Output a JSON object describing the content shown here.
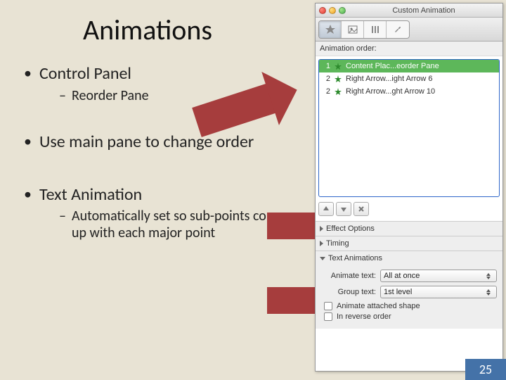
{
  "slide": {
    "title": "Animations",
    "bullets": [
      {
        "text": "Control Panel",
        "sub": [
          "Reorder Pane"
        ]
      },
      {
        "text": "Use main pane to change order",
        "sub": []
      },
      {
        "text": "Text Animation",
        "sub": [
          "Automatically set so sub-points come up with each major point"
        ]
      }
    ],
    "page_number": "25"
  },
  "panel": {
    "title": "Custom Animation",
    "subheader": "Animation order:",
    "rows": [
      {
        "num": "1",
        "label": "Content Plac...eorder Pane",
        "selected": true
      },
      {
        "num": "2",
        "label": "Right Arrow...ight Arrow 6",
        "selected": false
      },
      {
        "num": "2",
        "label": "Right Arrow...ght Arrow 10",
        "selected": false
      }
    ],
    "sections": {
      "effect": "Effect Options",
      "timing": "Timing",
      "textanim": "Text Animations"
    },
    "form": {
      "animate_text_label": "Animate text:",
      "animate_text_value": "All at once",
      "group_text_label": "Group text:",
      "group_text_value": "1st level",
      "check1": "Animate attached shape",
      "check2": "In reverse order"
    }
  }
}
